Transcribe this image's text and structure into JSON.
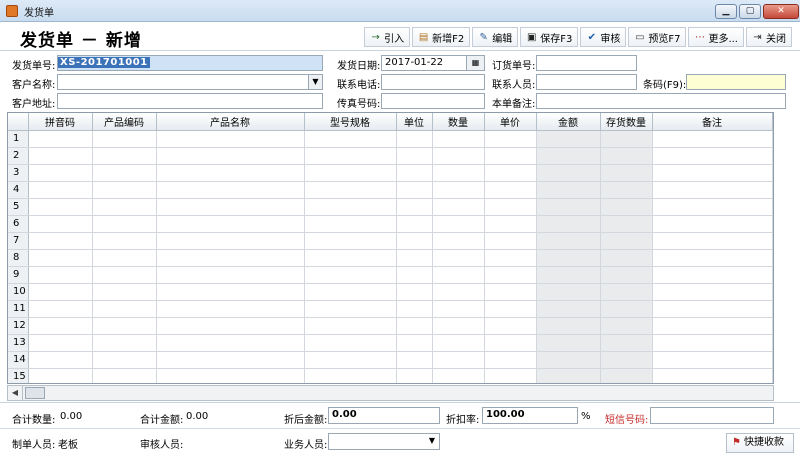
{
  "window": {
    "title": "发货单",
    "minimize_glyph": "▁",
    "maximize_glyph": "▢",
    "close_glyph": "✕"
  },
  "header": {
    "page_title": "发货单 － 新增"
  },
  "toolbar": {
    "import": "引入",
    "new": "新增F2",
    "edit": "编辑",
    "save": "保存F3",
    "approve": "审核",
    "preview": "预览F7",
    "more": "更多...",
    "close": "关闭"
  },
  "icons": {
    "import": "→",
    "new": "▤",
    "edit": "✎",
    "save": "▣",
    "approve": "✔",
    "preview": "▭",
    "more": "⋯",
    "close": "⇥",
    "dropdown": "▼",
    "calendar": "▦",
    "scroll_left": "◀",
    "flag": "⚑"
  },
  "form": {
    "order_no_label": "发货单号:",
    "order_no_value": "XS-201701001",
    "ship_date_label": "发货日期:",
    "ship_date_value": "2017-01-22",
    "order_ref_label": "订货单号:",
    "order_ref_value": "",
    "customer_label": "客户名称:",
    "customer_value": "",
    "phone_label": "联系电话:",
    "phone_value": "",
    "contact_label": "联系人员:",
    "contact_value": "",
    "barcode_label": "条码(F9):",
    "barcode_value": "",
    "address_label": "客户地址:",
    "address_value": "",
    "fax_label": "传真号码:",
    "fax_value": "",
    "note_label": "本单备注:",
    "note_value": ""
  },
  "grid": {
    "columns": [
      "拼音码",
      "产品编码",
      "产品名称",
      "型号规格",
      "单位",
      "数量",
      "单价",
      "金额",
      "存货数量",
      "备注"
    ],
    "row_numbers": [
      "1",
      "2",
      "3",
      "4",
      "5",
      "6",
      "7",
      "8",
      "9",
      "10",
      "11",
      "12",
      "13",
      "14",
      "15"
    ]
  },
  "footer": {
    "total_qty_label": "合计数量:",
    "total_qty_value": "0.00",
    "total_amount_label": "合计金额:",
    "total_amount_value": "0.00",
    "discount_amount_label": "折后金额:",
    "discount_amount_value": "0.00",
    "discount_rate_label": "折扣率:",
    "discount_rate_value": "100.00",
    "percent": "%",
    "sms_label": "短信号码:",
    "maker_label": "制单人员:",
    "maker_value": "老板",
    "auditor_label": "审核人员:",
    "auditor_value": "",
    "salesperson_label": "业务人员:",
    "salesperson_value": "",
    "quick_receipt": "快捷收款"
  }
}
